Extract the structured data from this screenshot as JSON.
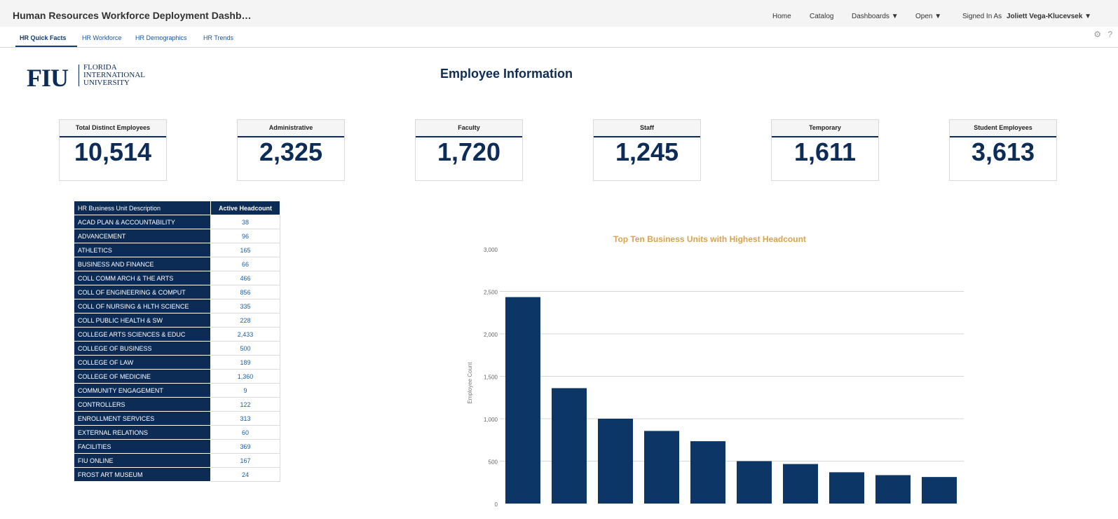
{
  "app": {
    "title": "Human Resources Workforce Deployment Dashb…",
    "nav": {
      "home": "Home",
      "catalog": "Catalog",
      "dashboards": "Dashboards ▼",
      "open": "Open ▼",
      "signed_in_label": "Signed In As",
      "user": "Joliett Vega-Klucevsek ▼"
    },
    "tabs": [
      "HR Quick Facts",
      "HR Workforce",
      "HR Demographics",
      "HR Trends"
    ],
    "active_tab": "HR Quick Facts",
    "icons": [
      "gear-icon",
      "help-icon"
    ]
  },
  "header": {
    "logo_mark": "FIU",
    "logo_lines": [
      "FLORIDA",
      "INTERNATIONAL",
      "UNIVERSITY"
    ],
    "title": "Employee Information"
  },
  "kpis": [
    {
      "label": "Total Distinct Employees",
      "value": "10,514"
    },
    {
      "label": "Administrative",
      "value": "2,325"
    },
    {
      "label": "Faculty",
      "value": "1,720"
    },
    {
      "label": "Staff",
      "value": "1,245"
    },
    {
      "label": "Temporary",
      "value": "1,611"
    },
    {
      "label": "Student Employees",
      "value": "3,613"
    }
  ],
  "table": {
    "headers": [
      "HR Business Unit Description",
      "Active Headcount"
    ],
    "rows": [
      [
        "ACAD PLAN & ACCOUNTABILITY",
        "38"
      ],
      [
        "ADVANCEMENT",
        "96"
      ],
      [
        "ATHLETICS",
        "165"
      ],
      [
        "BUSINESS AND FINANCE",
        "66"
      ],
      [
        "COLL COMM ARCH & THE ARTS",
        "466"
      ],
      [
        "COLL OF ENGINEERING & COMPUT",
        "856"
      ],
      [
        "COLL OF NURSING & HLTH SCIENCE",
        "335"
      ],
      [
        "COLL PUBLIC HEALTH & SW",
        "228"
      ],
      [
        "COLLEGE ARTS SCIENCES & EDUC",
        "2,433"
      ],
      [
        "COLLEGE OF BUSINESS",
        "500"
      ],
      [
        "COLLEGE OF LAW",
        "189"
      ],
      [
        "COLLEGE OF MEDICINE",
        "1,360"
      ],
      [
        "COMMUNITY ENGAGEMENT",
        "9"
      ],
      [
        "CONTROLLERS",
        "122"
      ],
      [
        "ENROLLMENT SERVICES",
        "313"
      ],
      [
        "EXTERNAL RELATIONS",
        "60"
      ],
      [
        "FACILITIES",
        "369"
      ],
      [
        "FIU ONLINE",
        "167"
      ],
      [
        "FROST ART MUSEUM",
        "24"
      ]
    ]
  },
  "chart_data": {
    "type": "bar",
    "title": "Top Ten Business Units with Highest Headcount",
    "xlabel": "",
    "ylabel": "Employee Count",
    "ylim": [
      0,
      3000
    ],
    "yticks": [
      "0",
      "500",
      "1,000",
      "1,500",
      "2,000",
      "2,500",
      "3,000"
    ],
    "grid": true,
    "values": [
      2433,
      1360,
      1000,
      856,
      735,
      500,
      466,
      369,
      335,
      313
    ],
    "bar_color": "#0c3666"
  }
}
